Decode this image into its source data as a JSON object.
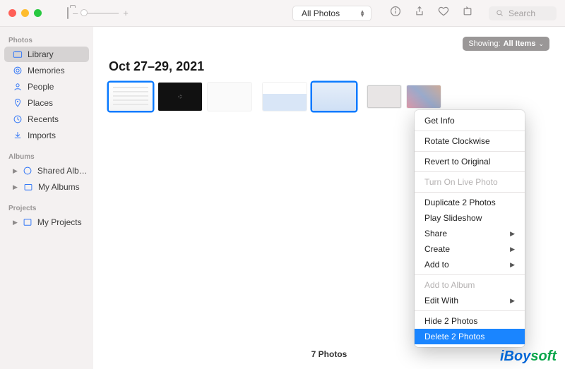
{
  "toolbar": {
    "zoom_minus": "–",
    "zoom_plus": "+",
    "filter_label": "All Photos",
    "search_placeholder": "Search"
  },
  "sidebar": {
    "sections": {
      "photos": "Photos",
      "albums": "Albums",
      "projects": "Projects"
    },
    "items": {
      "library": "Library",
      "memories": "Memories",
      "people": "People",
      "places": "Places",
      "recents": "Recents",
      "imports": "Imports",
      "shared": "Shared Alb…",
      "myalbums": "My Albums",
      "myprojects": "My Projects"
    }
  },
  "content": {
    "showing_prefix": "Showing:",
    "showing_value": "All Items",
    "date_heading": "Oct 27–29, 2021",
    "footer_count": "7 Photos"
  },
  "context_menu": {
    "get_info": "Get Info",
    "rotate": "Rotate Clockwise",
    "revert": "Revert to Original",
    "live_photo": "Turn On Live Photo",
    "duplicate": "Duplicate 2 Photos",
    "slideshow": "Play Slideshow",
    "share": "Share",
    "create": "Create",
    "add_to": "Add to",
    "add_album": "Add to Album",
    "edit_with": "Edit With",
    "hide": "Hide 2 Photos",
    "delete": "Delete 2 Photos"
  },
  "brand": {
    "part1": "iBoy",
    "part2": "soft"
  }
}
